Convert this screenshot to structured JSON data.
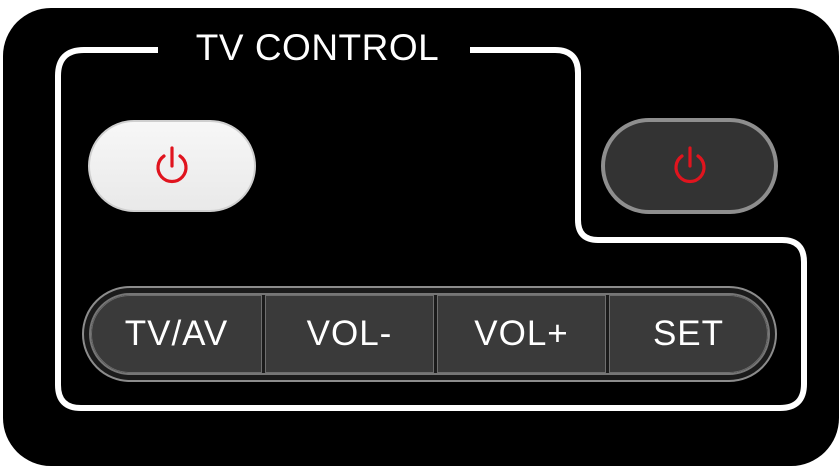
{
  "group": {
    "title": "TV CONTROL"
  },
  "power_buttons": [
    {
      "icon": "power-icon",
      "style": "light"
    },
    {
      "icon": "power-icon",
      "style": "dark"
    }
  ],
  "buttons": [
    {
      "label": "TV/AV"
    },
    {
      "label": "VOL-"
    },
    {
      "label": "VOL+"
    },
    {
      "label": "SET"
    }
  ],
  "colors": {
    "panel": "#000000",
    "outline": "#ffffff",
    "power_icon": "#e0141e",
    "segment": "#3a3a3a",
    "light_button": "#f2f2f2",
    "dark_button": "#333333"
  }
}
